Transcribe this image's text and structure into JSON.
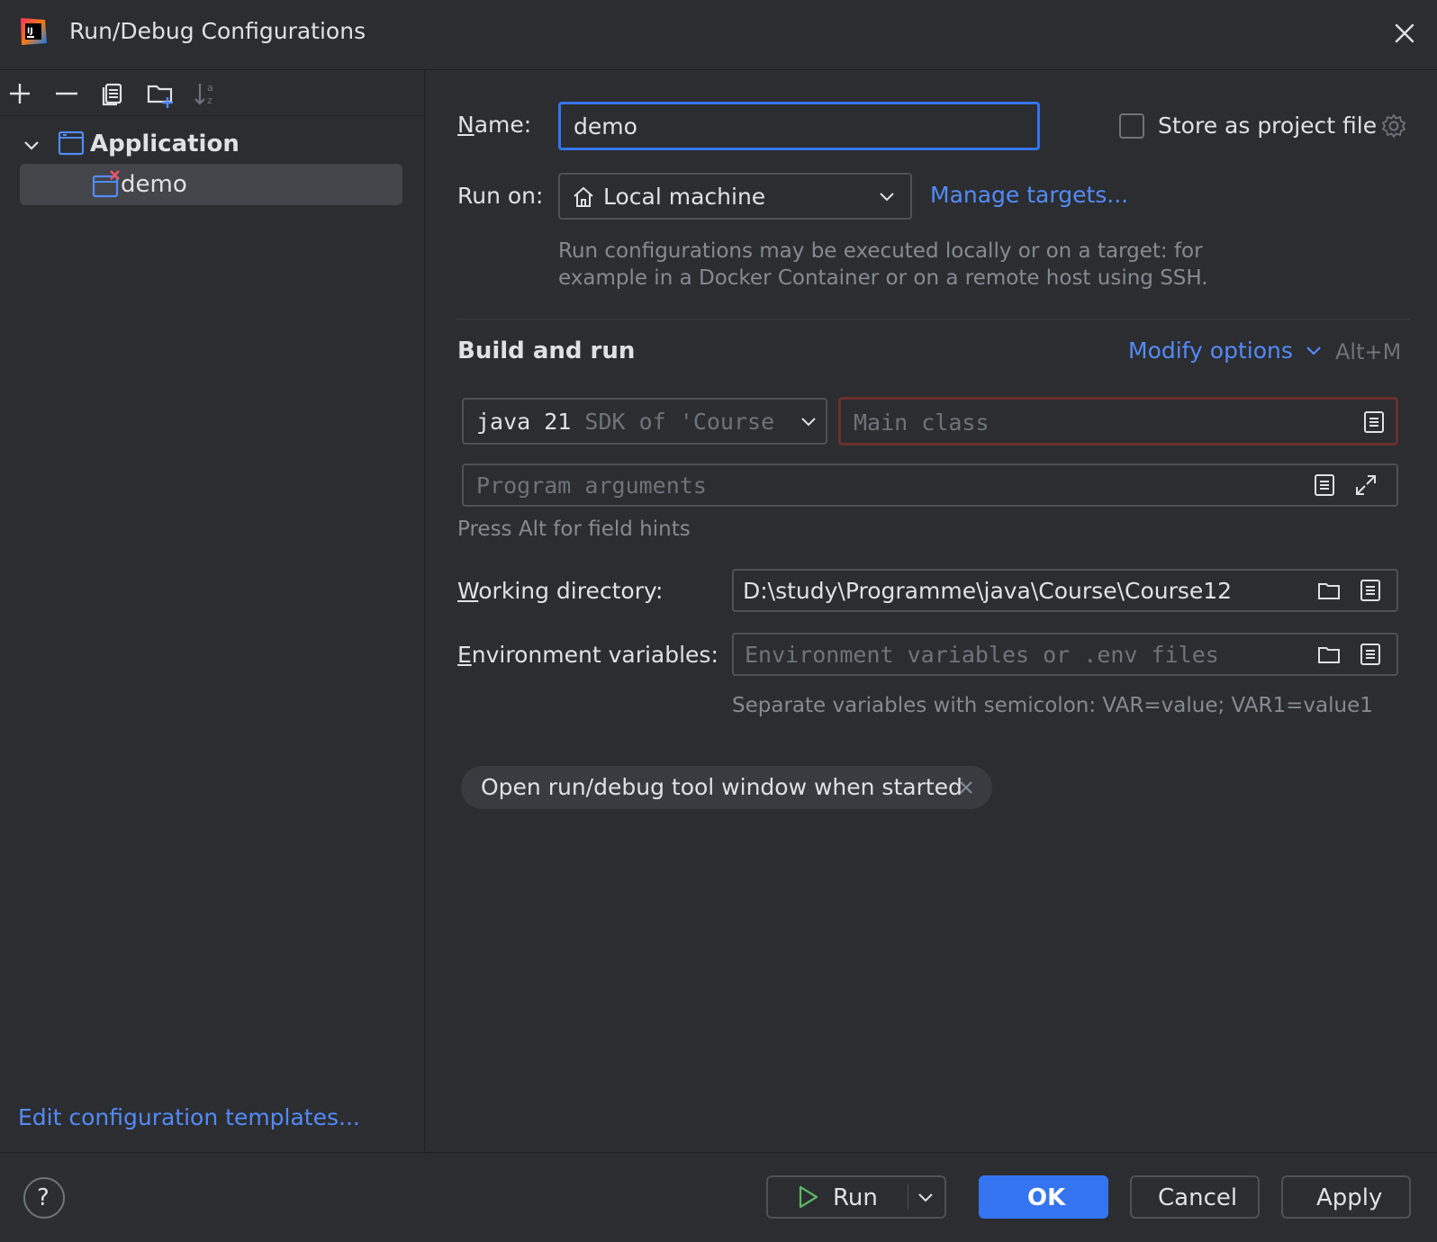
{
  "window": {
    "title": "Run/Debug Configurations"
  },
  "icons": {
    "app": "intellij-logo-icon",
    "close": "close-icon",
    "add": "plus-icon",
    "remove": "minus-icon",
    "copy": "copy-icon",
    "folder_add": "new-folder-icon",
    "sort": "sort-alpha-icon",
    "chevron_down": "chevron-down-icon",
    "app_config": "application-config-icon",
    "home": "home-icon",
    "gear": "gear-icon",
    "list": "list-icon",
    "expand": "expand-icon",
    "folder": "folder-icon",
    "run": "play-icon",
    "help": "help-icon"
  },
  "sidebar": {
    "tree": [
      {
        "label": "Application",
        "expanded": true
      },
      {
        "label": "demo",
        "selected": true,
        "has_error": true
      }
    ],
    "edit_templates": "Edit configuration templates..."
  },
  "form": {
    "name_label_underline": "N",
    "name_label_rest": "ame:",
    "name_value": "demo",
    "store_as_project_file": "Store as project file",
    "run_on_label": "Run on:",
    "run_on_value": "Local machine",
    "manage_targets": "Manage targets...",
    "run_on_hint_line1": "Run configurations may be executed locally or on a target: for",
    "run_on_hint_line2": "example in a Docker Container or on a remote host using SSH.",
    "section_title": "Build and run",
    "modify_options": "Modify options",
    "modify_shortcut": "Alt+M",
    "sdk_value": "java 21",
    "sdk_detail": "SDK of 'Course",
    "main_class_placeholder": "Main class",
    "program_args_placeholder": "Program arguments",
    "field_hint": "Press Alt for field hints",
    "working_dir_underline": "W",
    "working_dir_rest": "orking directory:",
    "working_dir_value": "D:\\study\\Programme\\java\\Course\\Course12",
    "env_vars_underline": "E",
    "env_vars_rest": "nvironment variables:",
    "env_vars_placeholder": "Environment variables or .env files",
    "env_vars_hint": "Separate variables with semicolon: VAR=value; VAR1=value1",
    "chip_label": "Open run/debug tool window when started"
  },
  "buttons": {
    "run": "Run",
    "ok": "OK",
    "cancel": "Cancel",
    "apply": "Apply",
    "help": "?"
  },
  "colors": {
    "accent": "#3574f0",
    "link": "#548af7",
    "error_border": "#6b2f2f",
    "background": "#2b2d30"
  }
}
